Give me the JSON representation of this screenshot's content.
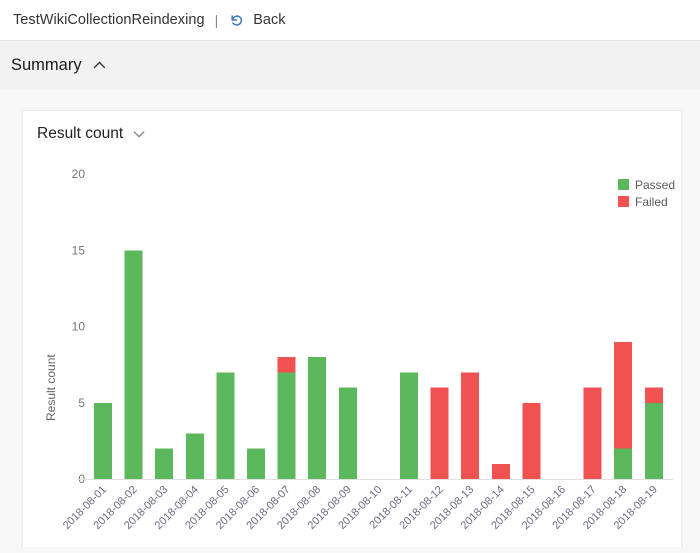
{
  "topbar": {
    "run_title": "TestWikiCollectionReindexing",
    "separator": "|",
    "back_label": "Back",
    "back_icon": "undo-arrow-icon"
  },
  "summary_section": {
    "label": "Summary",
    "chevron_icon": "chevron-up-icon",
    "expanded": true
  },
  "metric_selector": {
    "label": "Result count",
    "chevron_icon": "chevron-down-icon"
  },
  "colors": {
    "passed": "#5cb85c",
    "failed": "#f05252",
    "page_background": "#f8f8f8",
    "card_background": "#ffffff",
    "summary_header_background": "#f2f2f2",
    "axis_text": "#777777",
    "x_tick_text": "#6b6b87",
    "back_icon": "#3d76c4"
  },
  "chart_data": {
    "type": "bar",
    "stacked": true,
    "title": "",
    "xlabel": "",
    "ylabel": "Result count",
    "ylim": [
      0,
      20
    ],
    "yticks": [
      0,
      5,
      10,
      15,
      20
    ],
    "ytick_labels": [
      "0",
      "5",
      "10",
      "15",
      "20"
    ],
    "grid": false,
    "legend_position": "top-right",
    "categories": [
      "2018-08-01",
      "2018-08-02",
      "2018-08-03",
      "2018-08-04",
      "2018-08-05",
      "2018-08-06",
      "2018-08-07",
      "2018-08-08",
      "2018-08-09",
      "2018-08-10",
      "2018-08-11",
      "2018-08-12",
      "2018-08-13",
      "2018-08-14",
      "2018-08-15",
      "2018-08-16",
      "2018-08-17",
      "2018-08-18",
      "2018-08-19"
    ],
    "series": [
      {
        "name": "Passed",
        "color": "#5cb85c",
        "values": [
          5,
          15,
          2,
          3,
          7,
          2,
          7,
          8,
          6,
          0,
          7,
          0,
          0,
          0,
          0,
          0,
          0,
          2,
          5
        ]
      },
      {
        "name": "Failed",
        "color": "#f05252",
        "values": [
          0,
          0,
          0,
          0,
          0,
          0,
          1,
          0,
          0,
          0,
          0,
          6,
          7,
          1,
          5,
          0,
          6,
          7,
          1
        ]
      }
    ],
    "totals": [
      5,
      15,
      2,
      3,
      7,
      2,
      8,
      8,
      6,
      0,
      7,
      6,
      7,
      1,
      5,
      0,
      6,
      9,
      6
    ]
  }
}
